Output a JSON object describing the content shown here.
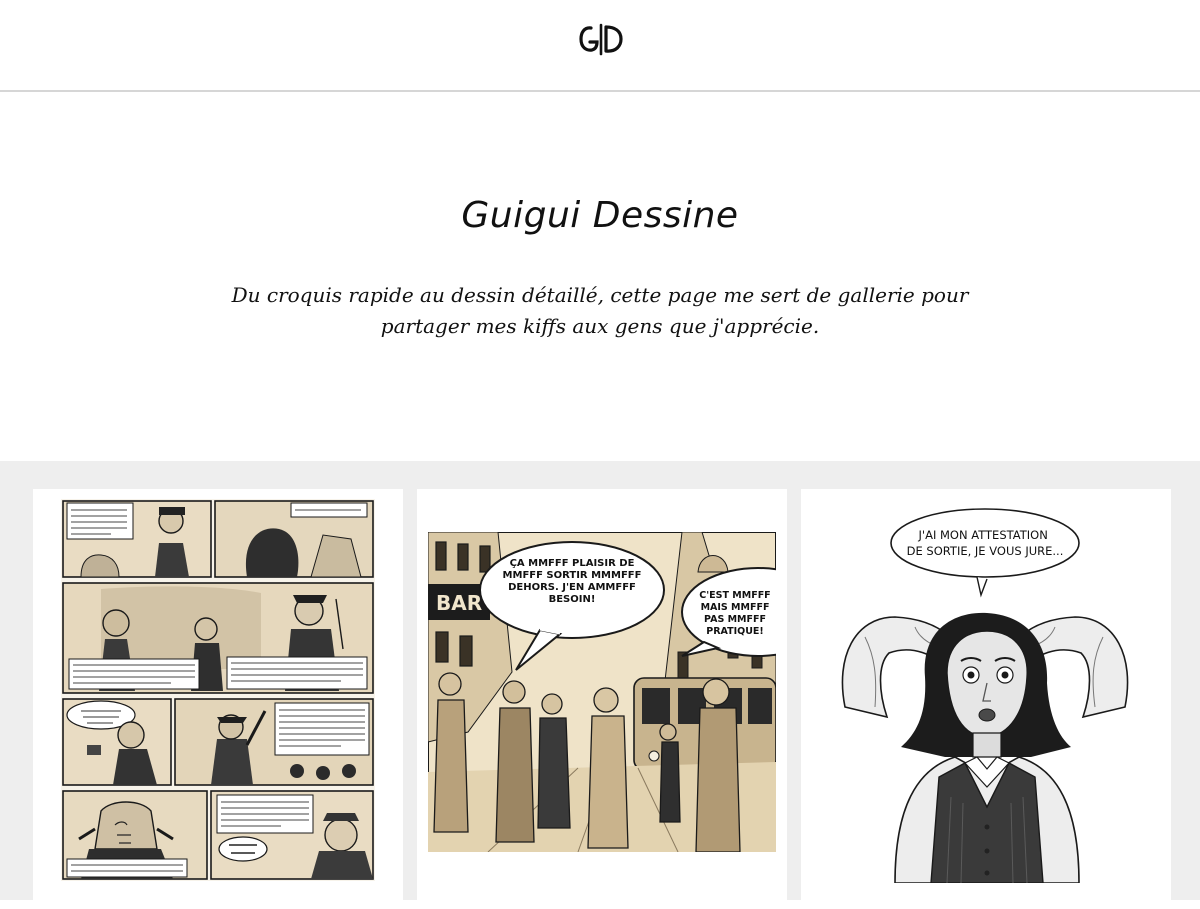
{
  "header": {
    "logo_text": "G|D"
  },
  "hero": {
    "title": "Guigui Dessine",
    "description": "Du croquis rapide au dessin détaillé, cette page me sert de gallerie pour partager mes kiffs aux gens que j'apprécie."
  },
  "gallery": {
    "items": [
      {
        "type": "comic-page",
        "captions": [
          "notre destination : l'année 2050. nous espérons que vous avez prévu un short car la température sera de 55° à l'arrivée.",
          "dernières années...",
          "sur votre droite, le continent de plastique, grand comme 3 fois la france. à notre arrivée en 2050, il y aura plus de plastique que de poissons dans les océans.",
          "nous ingérons chaque semaine de plastique, l'équivalent d'une carte de crédit. afin que vous ayez votre dose quotidienne, votre plateau-repas est intégralement emballé de cellophane.",
          "miam miam! une carte de crédit !",
          "nous demandons à chacun de rester assis et de la boucler tant que le symbole n'est pas allumé. l'important c'est la croissance ! il est allumé. c'est-à-dire pendant toute la durée du vol.",
          "en cas de dépression écologiste, des masques à gaz hilarant tomberont automatiquement du plafond.",
          "sac à déni",
          "ha ha ha ha ha!!",
          "le manque d'eau et les risques de famine à l'arrivée provoqueront des turbulences. vous trouverez un sac à"
        ]
      },
      {
        "type": "comic-panel",
        "sign": "BAR",
        "bubble_left": "ÇA MMFFF PLAISIR DE MMFFF SORTIR MMMFFF DEHORS. J'EN AMMFFF BESOIN!",
        "bubble_right": "C'EST MMFFF MAIS MMFFF PAS MMFFF PRATIQUE!"
      },
      {
        "type": "illustration",
        "bubble": [
          "J'AI MON ATTESTATION",
          "DE SORTIE, JE VOUS JURE..."
        ]
      }
    ]
  },
  "colors": {
    "page_bg": "#ffffff",
    "gallery_bg": "#eeeeee",
    "sepia": "#e9dcc3",
    "ink": "#1a1a1a"
  }
}
